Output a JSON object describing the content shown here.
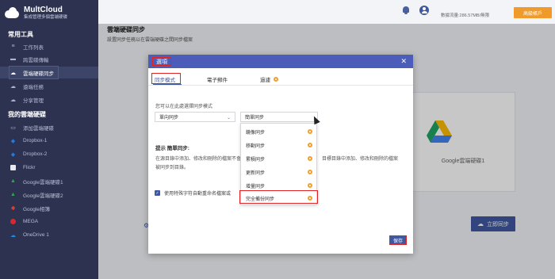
{
  "app": {
    "name": "MultCloud",
    "tagline": "集成管理多個雲端硬碟"
  },
  "sidebar": {
    "section_tools": "常用工具",
    "tools": [
      {
        "label": "工作列表",
        "icon": "list-icon"
      },
      {
        "label": "跨雲碟傳輸",
        "icon": "folder-icon"
      },
      {
        "label": "雲端硬碟同步",
        "icon": "cloud-sync-icon",
        "active": true
      },
      {
        "label": "遠端任務",
        "icon": "cloud-upload-icon"
      },
      {
        "label": "分享管理",
        "icon": "share-icon"
      }
    ],
    "section_drives": "我的雲端硬碟",
    "drives": [
      {
        "label": "添加雲端硬碟",
        "icon": "add-drive-icon"
      },
      {
        "label": "Dropbox-1",
        "icon": "dropbox-icon",
        "color": "#1f7de0"
      },
      {
        "label": "Dropbox-2",
        "icon": "dropbox-icon",
        "color": "#1f7de0"
      },
      {
        "label": "Flickr",
        "icon": "flickr-icon",
        "color": "#e8e8f0"
      },
      {
        "label": "Google雲端硬碟1",
        "icon": "google-drive-icon",
        "color": "#2da94f"
      },
      {
        "label": "Google雲端硬碟2",
        "icon": "google-drive-icon",
        "color": "#2da94f"
      },
      {
        "label": "Google相簿",
        "icon": "google-photos-icon",
        "color": "#e94335"
      },
      {
        "label": "MEGA",
        "icon": "mega-icon",
        "color": "#d9272e"
      },
      {
        "label": "OneDrive 1",
        "icon": "onedrive-icon",
        "color": "#1e88e5"
      }
    ]
  },
  "topbar": {
    "quota_text": "數據流量:286.57MB/無限",
    "upgrade_label": "高級帳戶"
  },
  "main": {
    "title": "雲端硬碟同步",
    "subtitle": "設置同步任務以在雲端硬碟之間同步檔案",
    "target_label": "Google雲端硬碟1",
    "sync_now_label": "立即同步"
  },
  "dialog": {
    "title": "選項",
    "tabs": [
      "同步模式",
      "電子郵件",
      "過濾"
    ],
    "prompt": "您可以在此處選擇同步模式",
    "direction_value": "單向同步",
    "mode_value": "簡單同步",
    "hint_title": "提示 簡單同步:",
    "hint_text": "在源目錄中添加、修改和刪除的檔案不會被同步到目錄。",
    "hint_text_right": "目標目錄中添加、修改和刪除的檔案",
    "checkbox_label": "使用特殊字符自動重命名檔案或",
    "save_label": "保存",
    "dropdown_items": [
      "鏡像同步",
      "移動同步",
      "累積同步",
      "更新同步",
      "增量同步",
      "完全備份同步"
    ]
  },
  "colors": {
    "sidebar_bg": "#2c3250",
    "accent": "#3f58a0",
    "dialog_header": "#4b5db8",
    "upgrade": "#f09a2c",
    "highlight": "#e02424"
  }
}
